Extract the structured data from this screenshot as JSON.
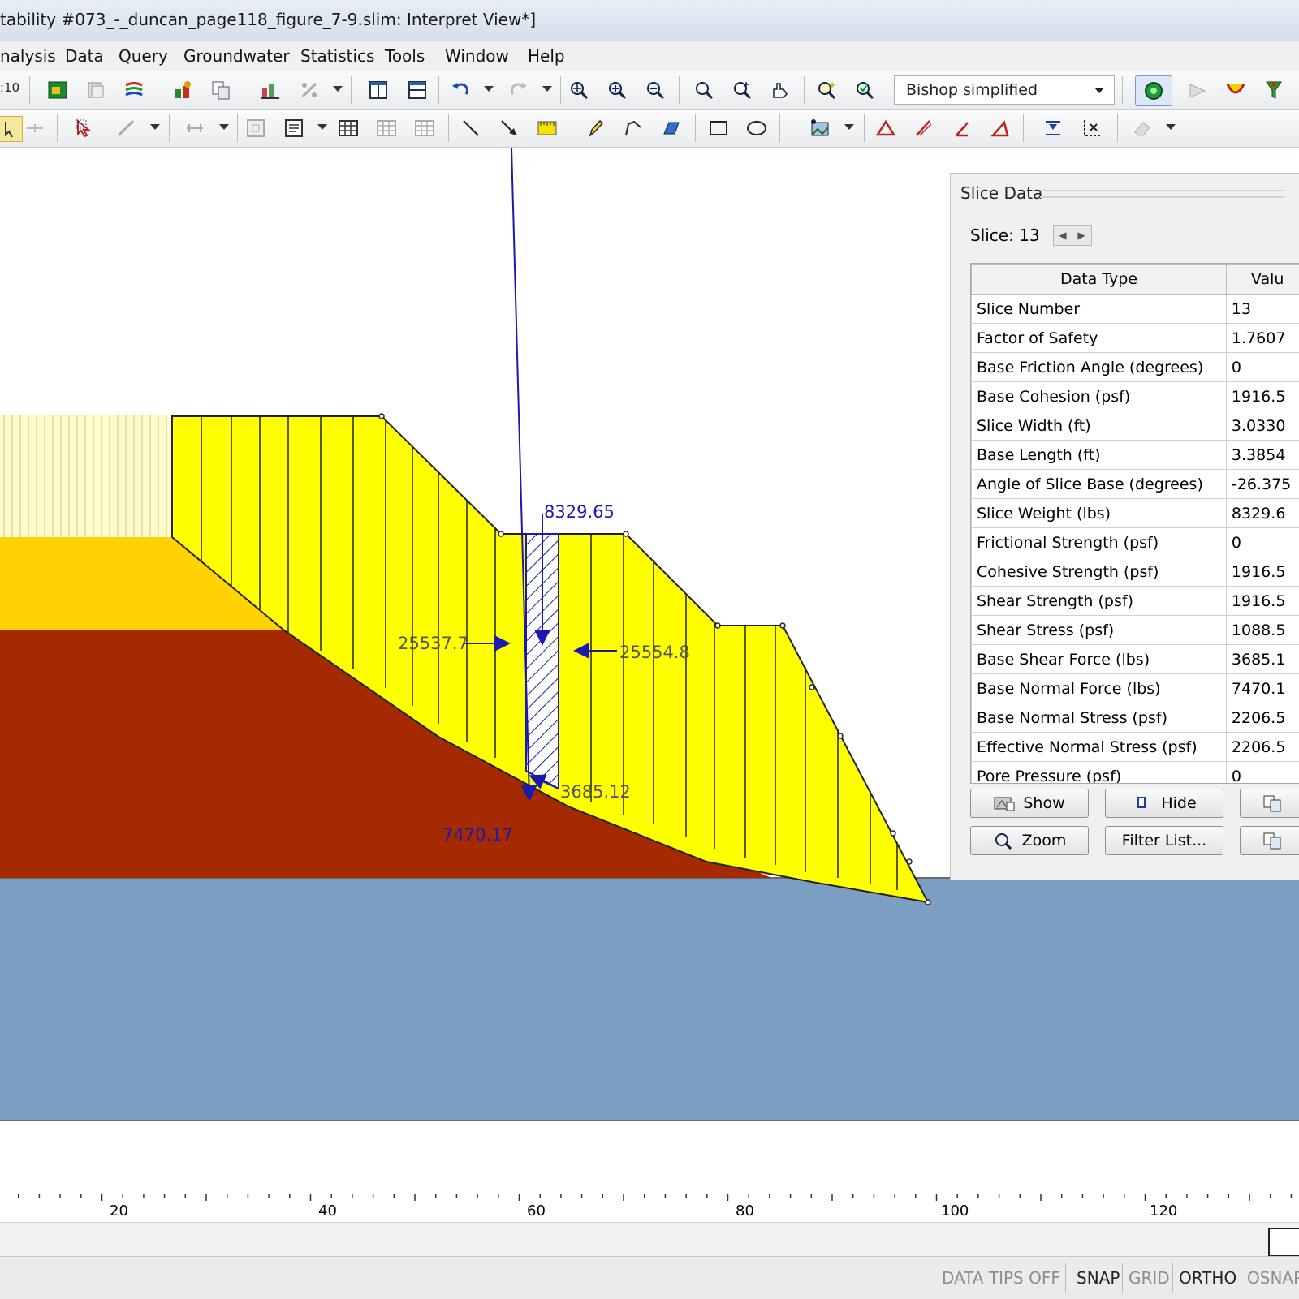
{
  "window": {
    "title": "tability #073_-_duncan_page118_figure_7-9.slim: Interpret View*]"
  },
  "menu": [
    "nalysis",
    "Data",
    "Query",
    "Groundwater",
    "Statistics",
    "Tools",
    "Window",
    "Help"
  ],
  "toolbar": {
    "left_stub": ":10",
    "method_select": "Bishop simplified"
  },
  "icons": [
    "zoom-all-icon",
    "zoom-in-icon",
    "zoom-out-icon",
    "undo-icon",
    "redo-icon",
    "show-slices-icon",
    "hide-slices-icon",
    "zoom-slice-icon",
    "copy-icon",
    "table-icon",
    "line-icon",
    "arrow-icon",
    "pencil-icon",
    "rectangle-icon",
    "ellipse-icon",
    "triangle-icon",
    "eraser-icon"
  ],
  "model": {
    "force_labels": {
      "weight": "8329.65",
      "left_interslice": "25537.7",
      "right_interslice": "25554.8",
      "base_shear": "3685.12",
      "base_normal": "7470.17"
    },
    "colors": {
      "slice_fill": "#ffff00",
      "upper_layer": "#ffd200",
      "middle_layer": "#a52a00",
      "bedrock": "#7b9ec2",
      "arrows": "#1a1ab0"
    }
  },
  "ruler": {
    "ticks": [
      "20",
      "40",
      "60",
      "80",
      "100",
      "120"
    ]
  },
  "panel": {
    "title": "Slice Data",
    "slice_label": "Slice: 13",
    "columns": [
      "Data Type",
      "Valu"
    ],
    "rows": [
      [
        "Slice Number",
        "13"
      ],
      [
        "Factor of Safety",
        "1.7607"
      ],
      [
        "Base Friction Angle (degrees)",
        "0"
      ],
      [
        "Base Cohesion (psf)",
        "1916.5"
      ],
      [
        "Slice Width (ft)",
        "3.0330"
      ],
      [
        "Base Length (ft)",
        "3.3854"
      ],
      [
        "Angle of Slice Base (degrees)",
        "-26.375"
      ],
      [
        "Slice Weight (lbs)",
        "8329.6"
      ],
      [
        "Frictional Strength (psf)",
        "0"
      ],
      [
        "Cohesive Strength (psf)",
        "1916.5"
      ],
      [
        "Shear Strength (psf)",
        "1916.5"
      ],
      [
        "Shear Stress (psf)",
        "1088.5"
      ],
      [
        "Base Shear Force (lbs)",
        "3685.1"
      ],
      [
        "Base Normal Force (lbs)",
        "7470.1"
      ],
      [
        "Base Normal Stress (psf)",
        "2206.5"
      ],
      [
        "Effective Normal Stress (psf)",
        "2206.5"
      ],
      [
        "Pore Pressure (psf)",
        "0"
      ]
    ],
    "buttons": {
      "show": "Show",
      "hide": "Hide",
      "zoom": "Zoom",
      "filter": "Filter List..."
    }
  },
  "status": {
    "data_tips": "DATA TIPS OFF",
    "snap": "SNAP",
    "grid": "GRID",
    "ortho": "ORTHO",
    "osnap": "OSNAP"
  }
}
